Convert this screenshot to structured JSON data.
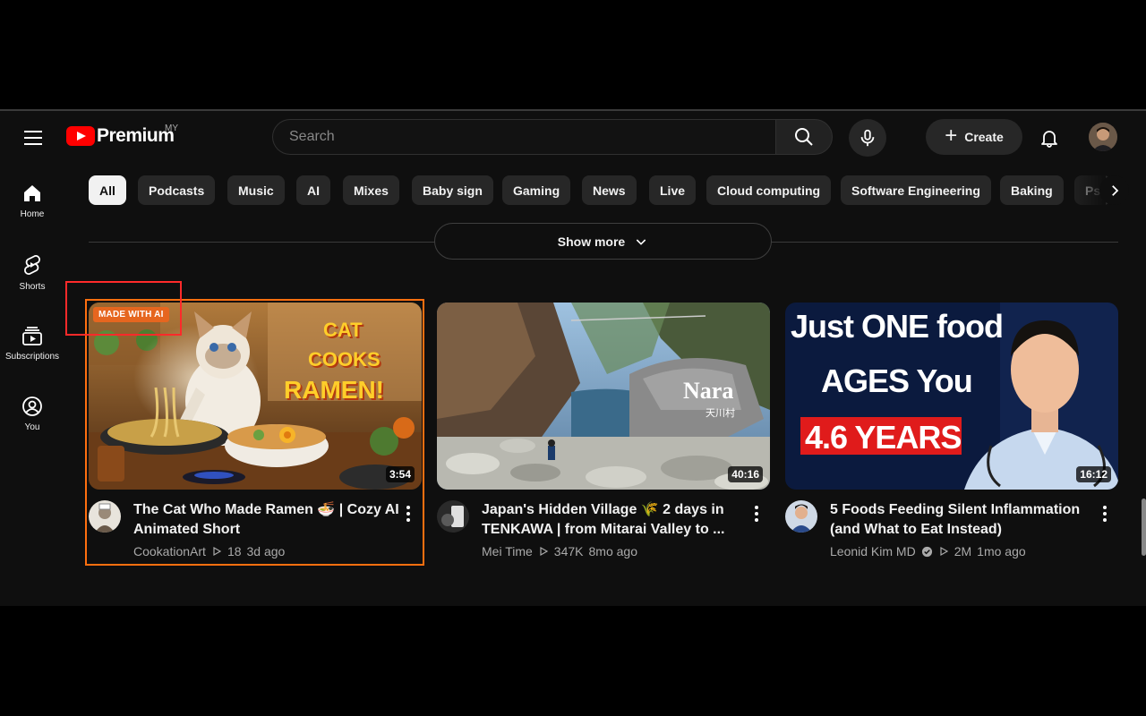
{
  "header": {
    "logo_text": "Premium",
    "region_code": "MY",
    "search_placeholder": "Search",
    "create_label": "Create"
  },
  "sidebar": {
    "items": [
      {
        "label": "Home",
        "icon": "home-icon"
      },
      {
        "label": "Shorts",
        "icon": "shorts-icon"
      },
      {
        "label": "Subscriptions",
        "icon": "subscriptions-icon"
      },
      {
        "label": "You",
        "icon": "you-icon"
      }
    ]
  },
  "chips": [
    "All",
    "Podcasts",
    "Music",
    "AI",
    "Mixes",
    "Baby sign",
    "Gaming",
    "News",
    "Live",
    "Cloud computing",
    "Software Engineering",
    "Baking",
    "Ps"
  ],
  "show_more_label": "Show more",
  "videos": [
    {
      "title": "The Cat Who Made Ramen 🍜 | Cozy AI Animated Short",
      "channel": "CookationArt",
      "views": "18",
      "age": "3d ago",
      "duration": "3:54",
      "badge": "MADE WITH AI",
      "thumb_text": [
        "CAT",
        "COOKS",
        "RAMEN!"
      ]
    },
    {
      "title": "Japan's Hidden Village 🌾 2 days in TENKAWA | from Mitarai Valley to ...",
      "channel": "Mei Time",
      "views": "347K",
      "age": "8mo ago",
      "duration": "40:16",
      "thumb_text": [
        "Nara",
        "天川村"
      ]
    },
    {
      "title": "5 Foods Feeding Silent Inflammation (and What to Eat Instead)",
      "channel": "Leonid Kim MD",
      "verified": true,
      "views": "2M",
      "age": "1mo ago",
      "duration": "16:12",
      "thumb_text": [
        "Just ONE food",
        "AGES You",
        "4.6 YEARS"
      ]
    }
  ],
  "colors": {
    "background": "#0f0f0f",
    "chip": "#272727",
    "brand_red": "#ff0000",
    "ai_badge": "#e6661f",
    "selection_orange": "#ff6f0f",
    "selection_red": "#ff2a2a"
  }
}
